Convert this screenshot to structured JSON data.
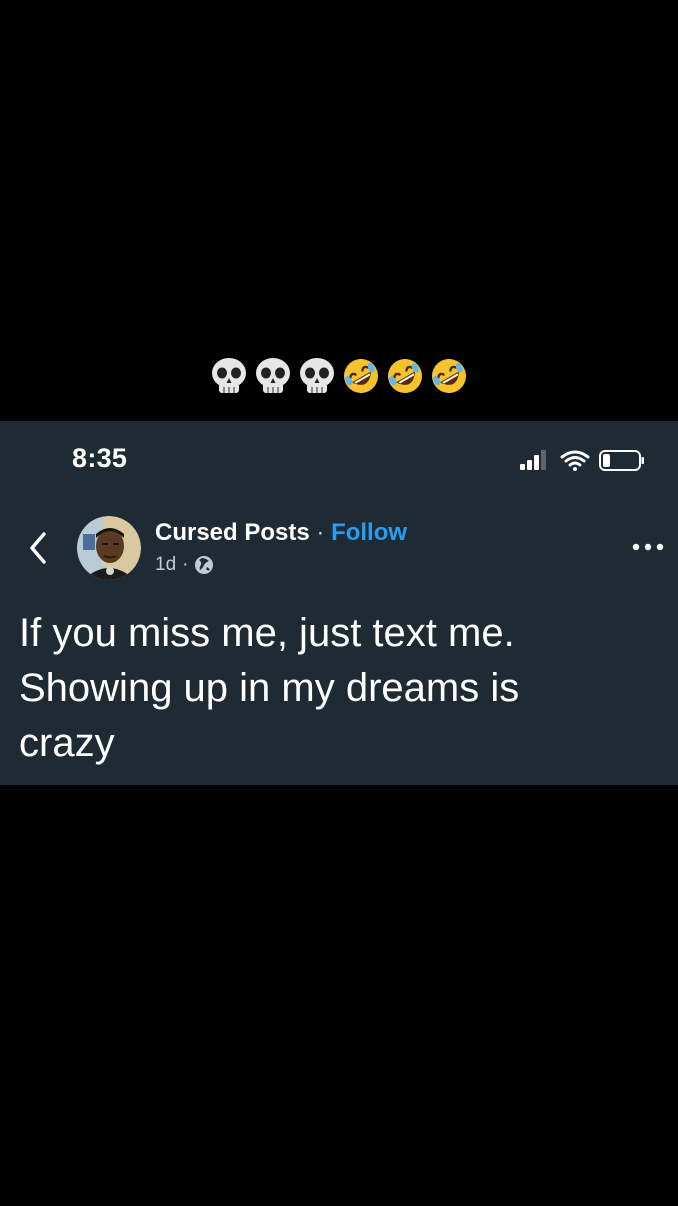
{
  "caption": {
    "emojis": [
      "skull",
      "skull",
      "skull",
      "rolling-on-floor-laughing",
      "rolling-on-floor-laughing",
      "rolling-on-floor-laughing"
    ]
  },
  "status_bar": {
    "time": "8:35",
    "icons": [
      "signal-icon",
      "wifi-icon",
      "battery-icon"
    ]
  },
  "post": {
    "author": "Cursed Posts",
    "separator": "·",
    "follow_label": "Follow",
    "age": "1d",
    "dot": "·",
    "visibility_icon": "globe-icon",
    "text": "If you miss me, just text me.\nShowing up in my dreams is\ncrazy"
  },
  "nav": {
    "back_icon": "chevron-left-icon",
    "more_icon": "more-options-icon"
  },
  "colors": {
    "page_background": "#000000",
    "card_background": "#1e2b35",
    "follow_link": "#2d9cf0",
    "text_primary": "#ffffff",
    "text_secondary": "#c3cbd2"
  }
}
